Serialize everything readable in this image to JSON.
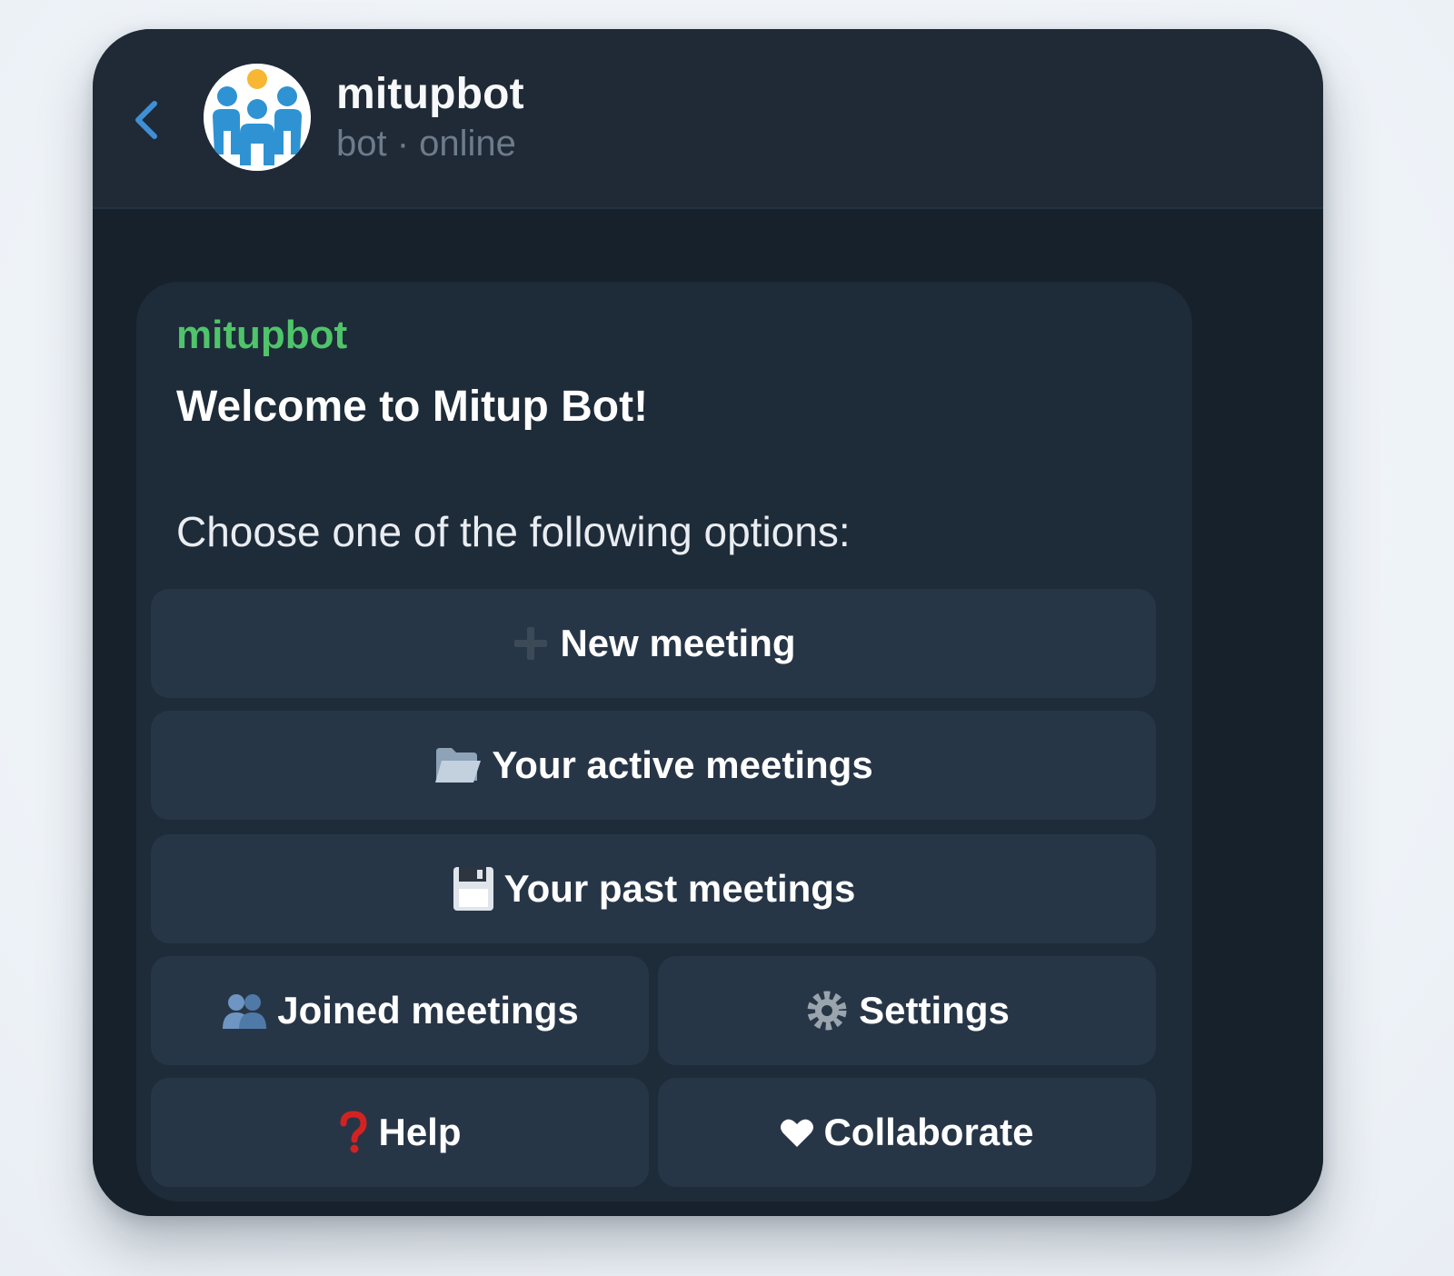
{
  "header": {
    "back_icon": "chevron-left-icon",
    "avatar_icon": "people-logo-icon",
    "bot_name": "mitupbot",
    "status": "bot · online"
  },
  "message": {
    "sender": "mitupbot",
    "welcome": "Welcome to Mitup Bot!",
    "prompt": "Choose one of the following options:"
  },
  "buttons": {
    "new_meeting": {
      "icon": "plus-icon",
      "label": "New meeting"
    },
    "active_meetings": {
      "icon": "open-folder-icon",
      "label": "Your active meetings"
    },
    "past_meetings": {
      "icon": "floppy-disk-icon",
      "label": "Your past meetings"
    },
    "joined_meetings": {
      "icon": "people-icon",
      "label": "Joined meetings"
    },
    "settings": {
      "icon": "gear-icon",
      "label": "Settings"
    },
    "help": {
      "icon": "question-mark-icon",
      "label": "Help"
    },
    "collaborate": {
      "icon": "heart-icon",
      "label": "Collaborate"
    }
  },
  "colors": {
    "window_background": "#17212b",
    "header_background": "#1f2a36",
    "bubble_background": "#1e2b39",
    "button_background": "#273647",
    "sender_name": "#4fc46a",
    "accent_blue": "#3f8fd6"
  }
}
